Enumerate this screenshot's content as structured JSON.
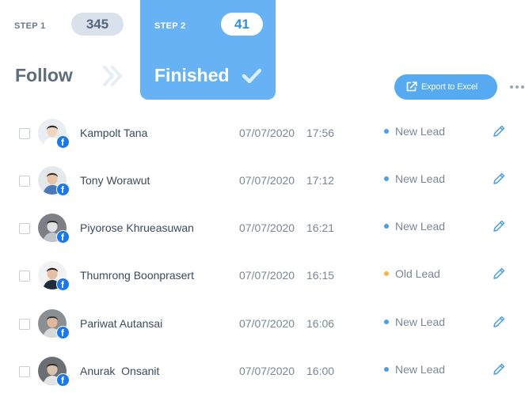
{
  "steps": [
    {
      "label": "STEP 1",
      "count": "345",
      "title": "Follow"
    },
    {
      "label": "STEP 2",
      "count": "41",
      "title": "Finished"
    }
  ],
  "export_button": {
    "label": "Export to Excel"
  },
  "colors": {
    "accent": "#66b2f5",
    "new_lead_dot": "#4a9fe8",
    "old_lead_dot": "#f5b53c",
    "facebook": "#1877f2"
  },
  "leads": [
    {
      "name": "Kampolt Tana",
      "date": "07/07/2020",
      "time": "17:56",
      "status": "New Lead",
      "status_color": "#4a9fe8",
      "source_icon": "facebook-icon"
    },
    {
      "name": "Tony Worawut",
      "date": "07/07/2020",
      "time": "17:12",
      "status": "New Lead",
      "status_color": "#4a9fe8",
      "source_icon": "facebook-icon"
    },
    {
      "name": "Piyorose Khrueasuwan",
      "date": "07/07/2020",
      "time": "16:21",
      "status": "New Lead",
      "status_color": "#4a9fe8",
      "source_icon": "facebook-icon"
    },
    {
      "name": "Thumrong Boonprasert",
      "date": "07/07/2020",
      "time": "16:15",
      "status": "Old Lead",
      "status_color": "#f5b53c",
      "source_icon": "facebook-icon"
    },
    {
      "name": "Pariwat Autansai",
      "date": "07/07/2020",
      "time": "16:06",
      "status": "New Lead",
      "status_color": "#4a9fe8",
      "source_icon": "facebook-icon"
    },
    {
      "name": "Anurak  Onsanit",
      "date": "07/07/2020",
      "time": "16:00",
      "status": "New Lead",
      "status_color": "#4a9fe8",
      "source_icon": "facebook-icon"
    }
  ]
}
